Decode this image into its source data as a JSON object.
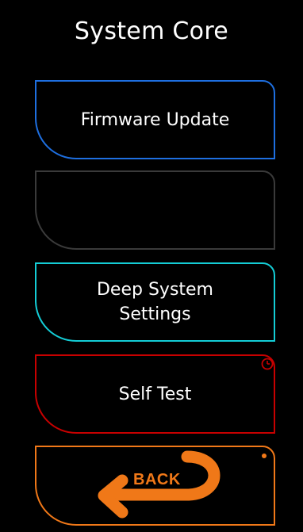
{
  "screen": {
    "title": "System Core"
  },
  "buttons": {
    "firmware_update": "Firmware Update",
    "empty_slot": "",
    "deep_system_settings": "Deep System\nSettings",
    "self_test": "Self Test",
    "back": "BACK"
  },
  "icons": {
    "self_test_badge": "clock-icon",
    "back_badge": "dot-indicator",
    "back_arrow": "curved-arrow-left-icon"
  },
  "colors": {
    "firmware_update": "#1e6fe0",
    "empty_slot": "#3a3a3a",
    "deep_system_settings": "#14cdd6",
    "self_test": "#c80000",
    "back": "#f07818"
  }
}
